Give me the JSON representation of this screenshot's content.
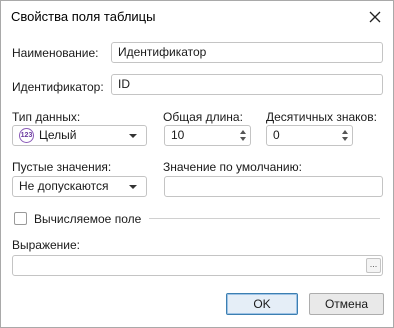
{
  "window": {
    "title": "Свойства поля таблицы"
  },
  "form": {
    "name_label": "Наименование:",
    "name_value": "Идентификатор",
    "id_label": "Идентификатор:",
    "id_value": "ID",
    "data_type_label": "Тип данных:",
    "data_type_icon_text": "123",
    "data_type_value": "Целый",
    "total_length_label": "Общая длина:",
    "total_length_value": "10",
    "decimal_places_label": "Десятичных знаков:",
    "decimal_places_value": "0",
    "nulls_label": "Пустые значения:",
    "nulls_value": "Не допускаются",
    "default_label": "Значение по умолчанию:",
    "default_value": "",
    "computed_label": "Вычисляемое поле",
    "computed_checked": false,
    "expression_label": "Выражение:",
    "expression_value": "",
    "browse_label": "..."
  },
  "buttons": {
    "ok": "OK",
    "cancel": "Отмена"
  }
}
